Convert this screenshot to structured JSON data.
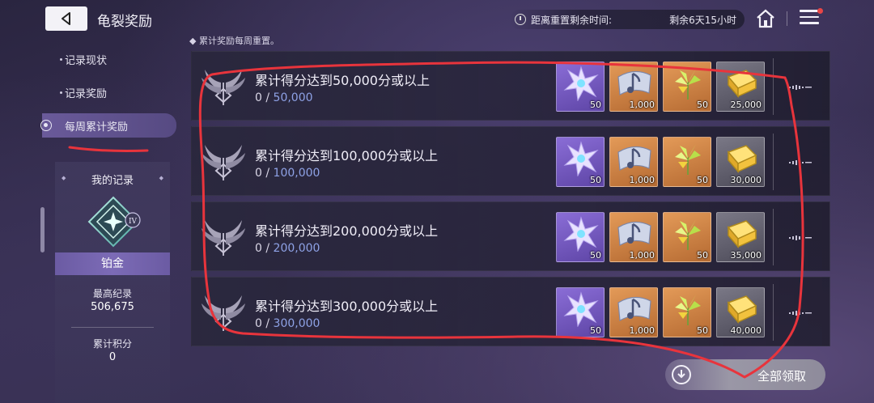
{
  "header": {
    "title": "龟裂奖励",
    "reset_label": "距离重置剩余时间:",
    "reset_remaining": "剩余6天15小时"
  },
  "sidebar": {
    "items": [
      {
        "label": "记录现状",
        "active": false
      },
      {
        "label": "记录奖励",
        "active": false
      },
      {
        "label": "每周累计奖励",
        "active": true
      }
    ]
  },
  "record": {
    "title": "我的记录",
    "rank_numeral": "IV",
    "rank_name": "铂金",
    "best_label": "最高纪录",
    "best_value": "506,675",
    "accum_label": "累计积分",
    "accum_value": "0"
  },
  "note": "累计奖励每周重置。",
  "rewards": [
    {
      "goal": "累计得分达到50,000分或以上",
      "current": "0",
      "target": "50,000",
      "items": [
        {
          "icon": "purple-star-crystal-icon",
          "color": "purple",
          "qty": "50"
        },
        {
          "icon": "music-note-ribbon-icon",
          "color": "orange",
          "qty": "1,000"
        },
        {
          "icon": "green-crystal-sprout-icon",
          "color": "orange",
          "qty": "50"
        },
        {
          "icon": "gold-ingot-icon",
          "color": "gray",
          "qty": "25,000"
        }
      ]
    },
    {
      "goal": "累计得分达到100,000分或以上",
      "current": "0",
      "target": "100,000",
      "items": [
        {
          "icon": "purple-star-crystal-icon",
          "color": "purple",
          "qty": "50"
        },
        {
          "icon": "music-note-ribbon-icon",
          "color": "orange",
          "qty": "1,000"
        },
        {
          "icon": "green-crystal-sprout-icon",
          "color": "orange",
          "qty": "50"
        },
        {
          "icon": "gold-ingot-icon",
          "color": "gray",
          "qty": "30,000"
        }
      ]
    },
    {
      "goal": "累计得分达到200,000分或以上",
      "current": "0",
      "target": "200,000",
      "items": [
        {
          "icon": "purple-star-crystal-icon",
          "color": "purple",
          "qty": "50"
        },
        {
          "icon": "music-note-ribbon-icon",
          "color": "orange",
          "qty": "1,000"
        },
        {
          "icon": "green-crystal-sprout-icon",
          "color": "orange",
          "qty": "50"
        },
        {
          "icon": "gold-ingot-icon",
          "color": "gray",
          "qty": "35,000"
        }
      ]
    },
    {
      "goal": "累计得分达到300,000分或以上",
      "current": "0",
      "target": "300,000",
      "items": [
        {
          "icon": "purple-star-crystal-icon",
          "color": "purple",
          "qty": "50"
        },
        {
          "icon": "music-note-ribbon-icon",
          "color": "orange",
          "qty": "1,000"
        },
        {
          "icon": "green-crystal-sprout-icon",
          "color": "orange",
          "qty": "50"
        },
        {
          "icon": "gold-ingot-icon",
          "color": "gray",
          "qty": "40,000"
        }
      ]
    }
  ],
  "claim_all_label": "全部领取",
  "colors": {
    "accent_purple": "#6a5a9a",
    "progress_target": "#8ea2e6",
    "annotation_red": "#e8343c",
    "notification_dot": "#e84646"
  }
}
